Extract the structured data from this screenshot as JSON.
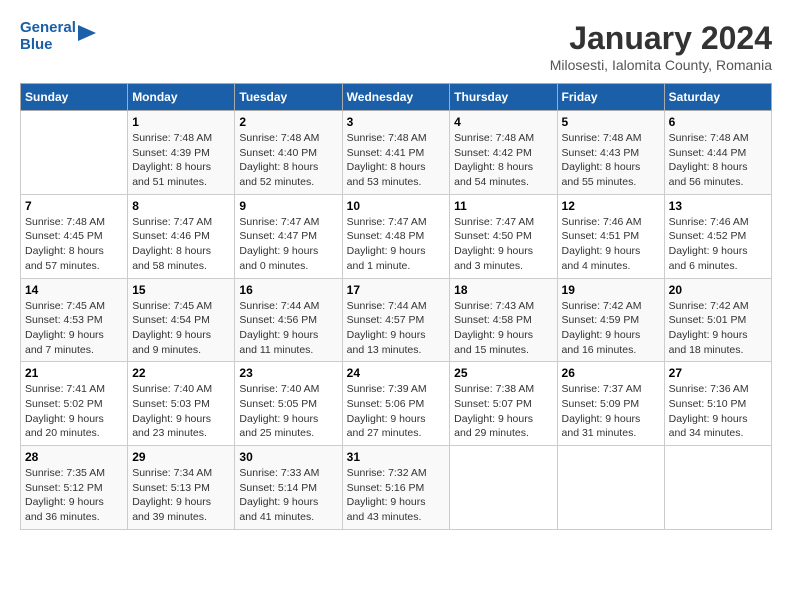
{
  "header": {
    "logo_line1": "General",
    "logo_line2": "Blue",
    "title": "January 2024",
    "subtitle": "Milosesti, Ialomita County, Romania"
  },
  "columns": [
    "Sunday",
    "Monday",
    "Tuesday",
    "Wednesday",
    "Thursday",
    "Friday",
    "Saturday"
  ],
  "weeks": [
    {
      "days": [
        {
          "num": "",
          "info": ""
        },
        {
          "num": "1",
          "info": "Sunrise: 7:48 AM\nSunset: 4:39 PM\nDaylight: 8 hours\nand 51 minutes."
        },
        {
          "num": "2",
          "info": "Sunrise: 7:48 AM\nSunset: 4:40 PM\nDaylight: 8 hours\nand 52 minutes."
        },
        {
          "num": "3",
          "info": "Sunrise: 7:48 AM\nSunset: 4:41 PM\nDaylight: 8 hours\nand 53 minutes."
        },
        {
          "num": "4",
          "info": "Sunrise: 7:48 AM\nSunset: 4:42 PM\nDaylight: 8 hours\nand 54 minutes."
        },
        {
          "num": "5",
          "info": "Sunrise: 7:48 AM\nSunset: 4:43 PM\nDaylight: 8 hours\nand 55 minutes."
        },
        {
          "num": "6",
          "info": "Sunrise: 7:48 AM\nSunset: 4:44 PM\nDaylight: 8 hours\nand 56 minutes."
        }
      ]
    },
    {
      "days": [
        {
          "num": "7",
          "info": "Sunrise: 7:48 AM\nSunset: 4:45 PM\nDaylight: 8 hours\nand 57 minutes."
        },
        {
          "num": "8",
          "info": "Sunrise: 7:47 AM\nSunset: 4:46 PM\nDaylight: 8 hours\nand 58 minutes."
        },
        {
          "num": "9",
          "info": "Sunrise: 7:47 AM\nSunset: 4:47 PM\nDaylight: 9 hours\nand 0 minutes."
        },
        {
          "num": "10",
          "info": "Sunrise: 7:47 AM\nSunset: 4:48 PM\nDaylight: 9 hours\nand 1 minute."
        },
        {
          "num": "11",
          "info": "Sunrise: 7:47 AM\nSunset: 4:50 PM\nDaylight: 9 hours\nand 3 minutes."
        },
        {
          "num": "12",
          "info": "Sunrise: 7:46 AM\nSunset: 4:51 PM\nDaylight: 9 hours\nand 4 minutes."
        },
        {
          "num": "13",
          "info": "Sunrise: 7:46 AM\nSunset: 4:52 PM\nDaylight: 9 hours\nand 6 minutes."
        }
      ]
    },
    {
      "days": [
        {
          "num": "14",
          "info": "Sunrise: 7:45 AM\nSunset: 4:53 PM\nDaylight: 9 hours\nand 7 minutes."
        },
        {
          "num": "15",
          "info": "Sunrise: 7:45 AM\nSunset: 4:54 PM\nDaylight: 9 hours\nand 9 minutes."
        },
        {
          "num": "16",
          "info": "Sunrise: 7:44 AM\nSunset: 4:56 PM\nDaylight: 9 hours\nand 11 minutes."
        },
        {
          "num": "17",
          "info": "Sunrise: 7:44 AM\nSunset: 4:57 PM\nDaylight: 9 hours\nand 13 minutes."
        },
        {
          "num": "18",
          "info": "Sunrise: 7:43 AM\nSunset: 4:58 PM\nDaylight: 9 hours\nand 15 minutes."
        },
        {
          "num": "19",
          "info": "Sunrise: 7:42 AM\nSunset: 4:59 PM\nDaylight: 9 hours\nand 16 minutes."
        },
        {
          "num": "20",
          "info": "Sunrise: 7:42 AM\nSunset: 5:01 PM\nDaylight: 9 hours\nand 18 minutes."
        }
      ]
    },
    {
      "days": [
        {
          "num": "21",
          "info": "Sunrise: 7:41 AM\nSunset: 5:02 PM\nDaylight: 9 hours\nand 20 minutes."
        },
        {
          "num": "22",
          "info": "Sunrise: 7:40 AM\nSunset: 5:03 PM\nDaylight: 9 hours\nand 23 minutes."
        },
        {
          "num": "23",
          "info": "Sunrise: 7:40 AM\nSunset: 5:05 PM\nDaylight: 9 hours\nand 25 minutes."
        },
        {
          "num": "24",
          "info": "Sunrise: 7:39 AM\nSunset: 5:06 PM\nDaylight: 9 hours\nand 27 minutes."
        },
        {
          "num": "25",
          "info": "Sunrise: 7:38 AM\nSunset: 5:07 PM\nDaylight: 9 hours\nand 29 minutes."
        },
        {
          "num": "26",
          "info": "Sunrise: 7:37 AM\nSunset: 5:09 PM\nDaylight: 9 hours\nand 31 minutes."
        },
        {
          "num": "27",
          "info": "Sunrise: 7:36 AM\nSunset: 5:10 PM\nDaylight: 9 hours\nand 34 minutes."
        }
      ]
    },
    {
      "days": [
        {
          "num": "28",
          "info": "Sunrise: 7:35 AM\nSunset: 5:12 PM\nDaylight: 9 hours\nand 36 minutes."
        },
        {
          "num": "29",
          "info": "Sunrise: 7:34 AM\nSunset: 5:13 PM\nDaylight: 9 hours\nand 39 minutes."
        },
        {
          "num": "30",
          "info": "Sunrise: 7:33 AM\nSunset: 5:14 PM\nDaylight: 9 hours\nand 41 minutes."
        },
        {
          "num": "31",
          "info": "Sunrise: 7:32 AM\nSunset: 5:16 PM\nDaylight: 9 hours\nand 43 minutes."
        },
        {
          "num": "",
          "info": ""
        },
        {
          "num": "",
          "info": ""
        },
        {
          "num": "",
          "info": ""
        }
      ]
    }
  ]
}
